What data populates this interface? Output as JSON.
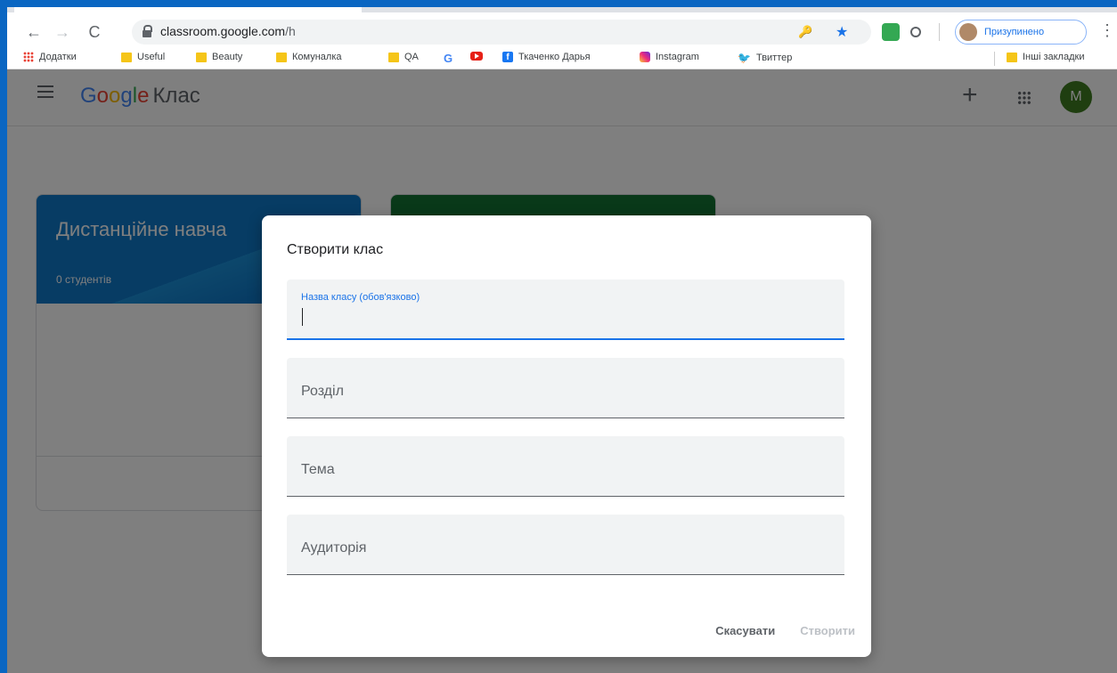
{
  "browser": {
    "url_host": "classroom.google.com",
    "url_path": "/h",
    "profile_status": "Призупинено",
    "bookmarks": [
      {
        "label": "Додатки",
        "icon": "apps-icon"
      },
      {
        "label": "Useful",
        "icon": "folder-icon"
      },
      {
        "label": "Beauty",
        "icon": "folder-icon"
      },
      {
        "label": "Комуналка",
        "icon": "folder-icon"
      },
      {
        "label": "QA",
        "icon": "folder-icon"
      },
      {
        "label": "",
        "icon": "google-icon"
      },
      {
        "label": "",
        "icon": "youtube-icon"
      },
      {
        "label": "Ткаченко Дарья",
        "icon": "facebook-icon"
      },
      {
        "label": "Instagram",
        "icon": "instagram-icon"
      },
      {
        "label": "Твиттер",
        "icon": "twitter-icon"
      }
    ],
    "other_bookmarks": "Інші закладки"
  },
  "app": {
    "logo_letters": [
      "G",
      "o",
      "o",
      "g",
      "l",
      "e"
    ],
    "product": "Клас",
    "avatar_letter": "M",
    "classes": [
      {
        "title": "Дистанційне навча",
        "students": "0 студентів"
      },
      {
        "title": "",
        "students": ""
      }
    ]
  },
  "dialog": {
    "title": "Створити клас",
    "fields": [
      {
        "label": "Назва класу (обов'язково)",
        "value": ""
      },
      {
        "placeholder": "Розділ"
      },
      {
        "placeholder": "Тема"
      },
      {
        "placeholder": "Аудиторія"
      }
    ],
    "cancel_label": "Скасувати",
    "create_label": "Створити"
  },
  "colors": {
    "accent": "#1a73e8",
    "frame_border": "#0a66c2",
    "class1_banner": "#0f78c8",
    "class2_banner": "#137333",
    "avatar": "#3f7d20"
  }
}
